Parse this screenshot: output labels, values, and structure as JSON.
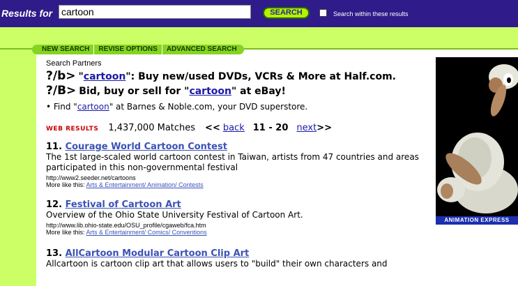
{
  "header": {
    "results_for_label": "Results for",
    "query": "cartoon",
    "search_button": "SEARCH",
    "search_within_label": "Search within these results"
  },
  "tabs": [
    {
      "label": "NEW SEARCH"
    },
    {
      "label": "REVISE OPTIONS"
    },
    {
      "label": "ADVANCED SEARCH"
    }
  ],
  "partners": {
    "label": "Search Partners",
    "ads": [
      {
        "icon": "?/b>",
        "pre": "\"",
        "link": "cartoon",
        "post": "\": Buy new/used DVDs, VCRs & More at Half.com."
      },
      {
        "icon": "?/B>",
        "pre": "Bid, buy or sell for \"",
        "link": "cartoon",
        "post": "\" at eBay!"
      }
    ],
    "find": {
      "bullet": "•",
      "pre": "Find \"",
      "link": "cartoon",
      "post": "\" at Barnes & Noble.com, your DVD superstore."
    }
  },
  "web_results": {
    "label": "WEB RESULTS",
    "matches": "1,437,000 Matches",
    "back_arrows": "<<",
    "back": "back",
    "range": "11 - 20",
    "next": "next",
    "next_arrows": ">>"
  },
  "results": [
    {
      "num": "11.",
      "title": "Courage World Cartoon Contest",
      "desc": "The 1st large-scaled world cartoon contest in Taiwan, artists from 47 countries and areas participated in this non-governmental festival",
      "url": "http://www2.seeder.net/cartoons",
      "more_label": "More like this:",
      "more_link": "Arts & Entertainment/ Animation/ Contests"
    },
    {
      "num": "12.",
      "title": "Festival of Cartoon Art",
      "desc": "Overview of the Ohio State University Festival of Cartoon Art.",
      "url": "http://www.lib.ohio-state.edu/OSU_profile/cgaweb/fca.htm",
      "more_label": "More like this:",
      "more_link": "Arts & Entertainment/ Comics/ Conventions"
    },
    {
      "num": "13.",
      "title": "AllCartoon Modular Cartoon Clip Art",
      "desc": "Allcartoon is cartoon clip art that allows users to \"build\" their own characters and"
    }
  ],
  "ad_image": {
    "caption": "ANIMATION EXPRESS",
    "icon": "sheep-animation-icon"
  },
  "colors": {
    "header_bg": "#2f1b8a",
    "green_band": "#ccff66",
    "tab_green": "#85d421",
    "link_blue": "#1a1aa6",
    "web_results_red": "#cc0000"
  }
}
